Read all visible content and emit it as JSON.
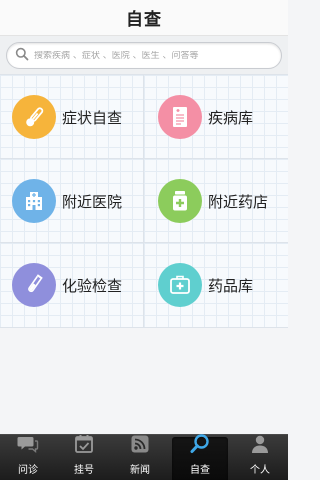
{
  "header": {
    "title": "自查"
  },
  "search": {
    "placeholder": "搜索疾病 、症状 、医院 、医生 、问答等"
  },
  "grid": {
    "items": [
      {
        "label": "症状自查",
        "icon": "thermometer-icon",
        "color": "#f6b43b"
      },
      {
        "label": "疾病库",
        "icon": "document-icon",
        "color": "#f48fa5"
      },
      {
        "label": "附近医院",
        "icon": "hospital-icon",
        "color": "#6fb3e8"
      },
      {
        "label": "附近药店",
        "icon": "medicine-bottle-icon",
        "color": "#8ccc5c"
      },
      {
        "label": "化验检查",
        "icon": "test-tube-icon",
        "color": "#8f8fdc"
      },
      {
        "label": "药品库",
        "icon": "medical-kit-icon",
        "color": "#5fcfcf"
      }
    ]
  },
  "tabbar": {
    "tabs": [
      {
        "label": "问诊",
        "icon": "chat-icon",
        "active": false
      },
      {
        "label": "挂号",
        "icon": "calendar-icon",
        "active": false
      },
      {
        "label": "新闻",
        "icon": "rss-icon",
        "active": false
      },
      {
        "label": "自查",
        "icon": "search-icon",
        "active": true
      },
      {
        "label": "个人",
        "icon": "person-icon",
        "active": false
      }
    ]
  }
}
